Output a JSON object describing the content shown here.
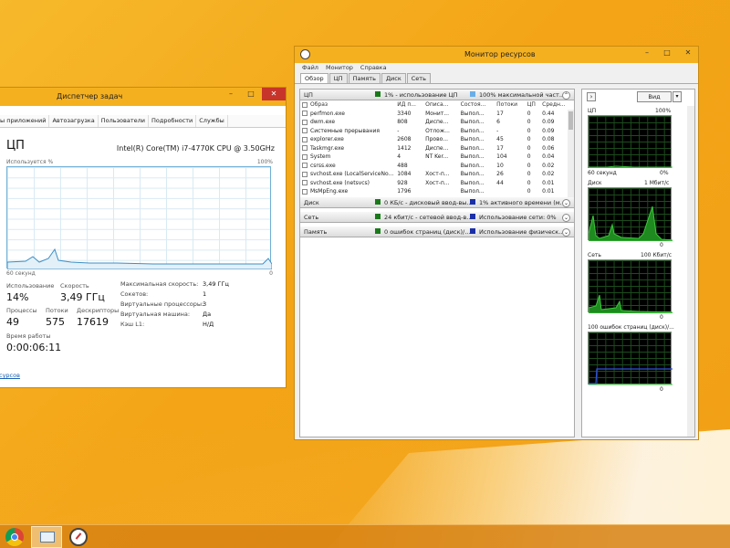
{
  "desktop": {
    "accent": "#f3a517"
  },
  "taskmgr": {
    "title": "Диспетчер задач",
    "tabs": [
      "ы приложений",
      "Автозагрузка",
      "Пользователи",
      "Подробности",
      "Службы"
    ],
    "cpu_heading": "ЦП",
    "cpu_model": "Intel(R) Core(TM) i7-4770K CPU @ 3.50GHz",
    "utilization_label": "Используется %",
    "max_label": "100%",
    "time_label": "60 секунд",
    "min_label": "0",
    "stats": {
      "use_label": "Использование",
      "use_value": "14%",
      "speed_label": "Скорость",
      "speed_value": "3,49 ГГц",
      "proc_label": "Процессы",
      "proc_value": "49",
      "threads_label": "Потоки",
      "threads_value": "575",
      "handles_label": "Дескрипторы",
      "handles_value": "17619",
      "uptime_label": "Время работы",
      "uptime_value": "0:00:06:11"
    },
    "details": [
      {
        "k": "Максимальная скорость:",
        "v": "3,49 ГГц"
      },
      {
        "k": "Сокетов:",
        "v": "1"
      },
      {
        "k": "Виртуальные процессоры:",
        "v": "3"
      },
      {
        "k": "Виртуальная машина:",
        "v": "Да"
      },
      {
        "k": "Кэш L1:",
        "v": "Н/Д"
      }
    ],
    "link": "сурсов"
  },
  "resmon": {
    "title": "Монитор ресурсов",
    "menu": [
      "Файл",
      "Монитор",
      "Справка"
    ],
    "tabs": [
      "Обзор",
      "ЦП",
      "Память",
      "Диск",
      "Сеть"
    ],
    "cpu_section": {
      "name": "ЦП",
      "stat1": "1% - использование ЦП",
      "stat2": "100% максимальной част..."
    },
    "columns": [
      "Образ",
      "ИД п...",
      "Описа...",
      "Состоя...",
      "Потоки",
      "ЦП",
      "Средн..."
    ],
    "rows": [
      [
        "perfmon.exe",
        "3340",
        "Монит...",
        "Выпол...",
        "17",
        "0",
        "0.44"
      ],
      [
        "dwm.exe",
        "808",
        "Диспе...",
        "Выпол...",
        "6",
        "0",
        "0.09"
      ],
      [
        "Системные прерывания",
        "-",
        "Отлож...",
        "Выпол...",
        "-",
        "0",
        "0.09"
      ],
      [
        "explorer.exe",
        "2608",
        "Прово...",
        "Выпол...",
        "45",
        "0",
        "0.08"
      ],
      [
        "Taskmgr.exe",
        "1412",
        "Диспе...",
        "Выпол...",
        "17",
        "0",
        "0.06"
      ],
      [
        "System",
        "4",
        "NT Ker...",
        "Выпол...",
        "104",
        "0",
        "0.04"
      ],
      [
        "csrss.exe",
        "488",
        "",
        "Выпол...",
        "10",
        "0",
        "0.02"
      ],
      [
        "svchost.exe (LocalServiceNo...",
        "1084",
        "Хост-п...",
        "Выпол...",
        "26",
        "0",
        "0.02"
      ],
      [
        "svchost.exe (netsvcs)",
        "928",
        "Хост-п...",
        "Выпол...",
        "44",
        "0",
        "0.01"
      ],
      [
        "MsMpEng.exe",
        "1796",
        "",
        "Выпол...",
        "",
        "0",
        "0.01"
      ]
    ],
    "disk": {
      "name": "Диск",
      "stat1": "0 КБ/с - дисковый ввод-вы...",
      "stat2": "1% активного времени (м..."
    },
    "net": {
      "name": "Сеть",
      "stat1": "24 кбит/с - сетевой ввод-в...",
      "stat2": "Использование сети: 0%"
    },
    "mem": {
      "name": "Память",
      "stat1": "0 ошибок страниц (диск)/...",
      "stat2": "Использование физическ..."
    },
    "view_label": "Вид",
    "graphs": [
      {
        "title": "ЦП",
        "max": "100%",
        "foot": "60 секунд",
        "foot_right": "0%"
      },
      {
        "title": "Диск",
        "max": "1 Мбит/с",
        "foot": "",
        "foot_right": "0"
      },
      {
        "title": "Сеть",
        "max": "100 Кбит/с",
        "foot": "",
        "foot_right": "0"
      },
      {
        "title": "100 ошибок страниц (диск)/...",
        "max": "",
        "foot": "",
        "foot_right": "0"
      }
    ]
  }
}
